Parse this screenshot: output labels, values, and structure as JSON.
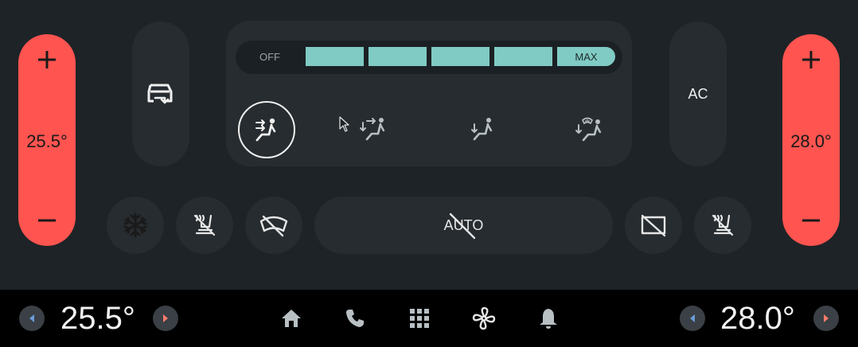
{
  "temperature": {
    "left": {
      "value": "25.5°",
      "plus_label": "+",
      "minus_label": "−"
    },
    "right": {
      "value": "28.0°",
      "plus_label": "+",
      "minus_label": "−"
    }
  },
  "recirculation": {
    "icon": "recirculation-icon"
  },
  "fan_speed": {
    "off_label": "OFF",
    "max_label": "MAX",
    "segments": 5,
    "level": 5,
    "fill_color": "#80cbc4"
  },
  "airflow_modes": [
    {
      "icon": "airflow-face-icon",
      "active": true
    },
    {
      "icon": "airflow-face-floor-icon",
      "active": false
    },
    {
      "icon": "airflow-floor-icon",
      "active": false
    },
    {
      "icon": "airflow-floor-defrost-icon",
      "active": false
    }
  ],
  "ac": {
    "label": "AC"
  },
  "auto": {
    "label": "AUTO",
    "state": "off"
  },
  "bottom_controls": [
    {
      "icon": "snowflake-icon"
    },
    {
      "icon": "heated-seat-left-off-icon"
    },
    {
      "icon": "front-defrost-off-icon"
    },
    {
      "icon": "rear-defrost-off-icon"
    },
    {
      "icon": "heated-seat-right-off-icon"
    }
  ],
  "navbar": {
    "left_temp": "25.5°",
    "right_temp": "28.0°",
    "icons": [
      "home-icon",
      "phone-icon",
      "apps-grid-icon",
      "fan-icon",
      "bell-icon"
    ]
  },
  "colors": {
    "temp_pill": "#ff5450",
    "accent_teal": "#80cbc4",
    "background": "#1e2327",
    "panel": "#262c30",
    "navbar": "#000000",
    "arrow_left": "#6a9bd8",
    "arrow_right": "#ff7b6e"
  }
}
